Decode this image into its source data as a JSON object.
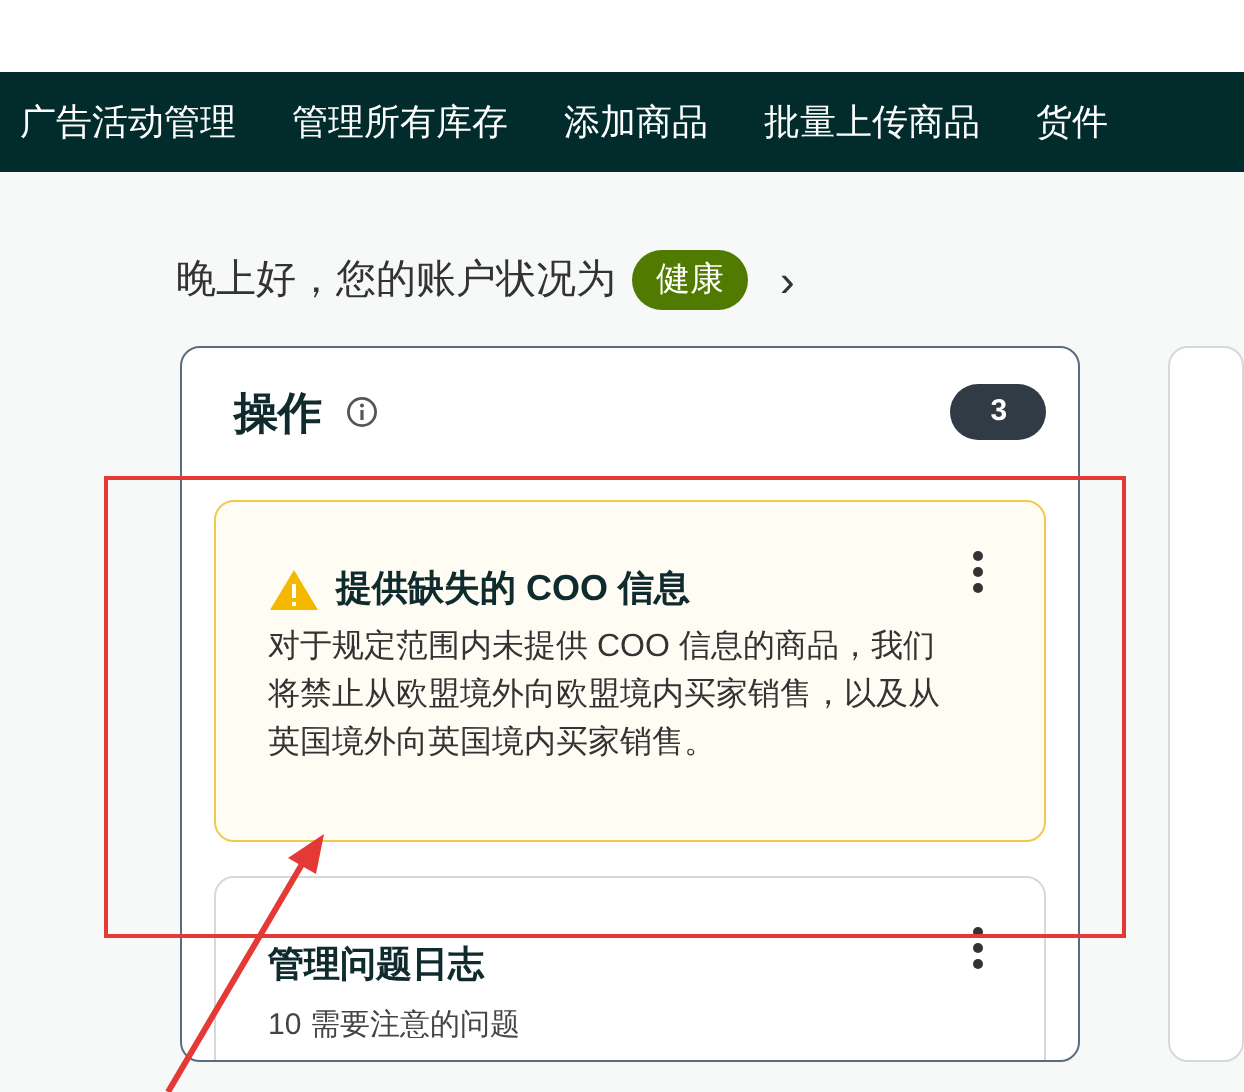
{
  "nav": {
    "items": [
      {
        "label": "广告活动管理"
      },
      {
        "label": "管理所有库存"
      },
      {
        "label": "添加商品"
      },
      {
        "label": "批量上传商品"
      },
      {
        "label": "货件"
      }
    ]
  },
  "greeting": {
    "text": "晚上好，您的账户状况为",
    "status": {
      "label": "健康",
      "color": "#507b00"
    },
    "chevron": "›"
  },
  "actions": {
    "title": "操作",
    "count": "3",
    "cards": [
      {
        "kind": "warning",
        "title": "提供缺失的 COO 信息",
        "body": "对于规定范围内未提供 COO 信息的商品，我们将禁止从欧盟境外向欧盟境内买家销售，以及从英国境外向英国境内买家销售。"
      },
      {
        "kind": "plain",
        "title": "管理问题日志",
        "count": "10",
        "body": "需要注意的问题"
      }
    ]
  }
}
